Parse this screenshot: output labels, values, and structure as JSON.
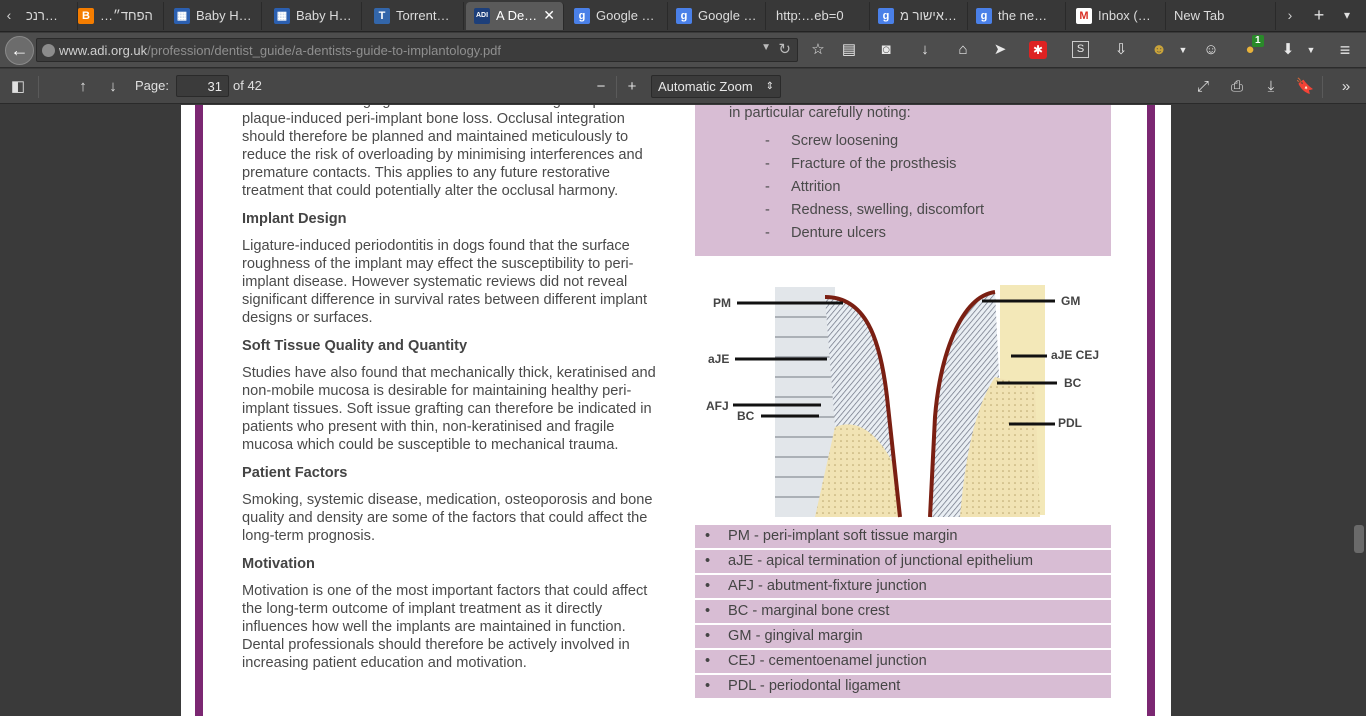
{
  "browser": {
    "tabs": [
      {
        "title": "רנכ…",
        "favicon": "none"
      },
      {
        "title": "…הפחד״",
        "favicon": "orange-blogger"
      },
      {
        "title": "Baby H…",
        "favicon": "colorful-grid"
      },
      {
        "title": "Baby H…",
        "favicon": "colorful-grid"
      },
      {
        "title": "Torrent…",
        "favicon": "torrent-t"
      },
      {
        "title": "A De…",
        "favicon": "adi-logo",
        "active": true
      },
      {
        "title": "Google …",
        "favicon": "google-g"
      },
      {
        "title": "Google …",
        "favicon": "google-g"
      },
      {
        "title": "http:…eb=0",
        "favicon": "none"
      },
      {
        "title": "אישור מ…",
        "favicon": "google-g"
      },
      {
        "title": "the ne…",
        "favicon": "google-g"
      },
      {
        "title": "Inbox (…",
        "favicon": "gmail-m"
      },
      {
        "title": "New Tab",
        "favicon": "none"
      }
    ],
    "tab_close_glyph": "✕",
    "newtab_glyph": "+",
    "url_domain": "www.adi.org.uk",
    "url_path": "/profession/dentist_guide/a-dentists-guide-to-implantology.pdf",
    "addon_badge": "1"
  },
  "pdf_toolbar": {
    "page_label": "Page:",
    "page_number": "31",
    "page_count": "of 42",
    "zoom": "Automatic Zoom"
  },
  "document": {
    "top_partial": "There is also emerging evidence that overloading can potentiate plaque-induced peri-implant bone loss. Occlusal integration should therefore be planned and maintained meticulously to reduce the risk of overloading by minimising interferences and premature contacts. This applies to any future restorative treatment that could potentially alter the occlusal harmony.",
    "sections": [
      {
        "heading": "Implant Design",
        "text": "Ligature-induced periodontitis in dogs found that the surface roughness of the implant may effect the susceptibility to peri-implant disease. However systematic reviews did not reveal significant difference in survival rates between different implant designs or surfaces."
      },
      {
        "heading": "Soft Tissue Quality and Quantity",
        "text": "Studies have also found that mechanically thick, keratinised and non-mobile mucosa is desirable for maintaining healthy peri-implant tissues. Soft issue grafting can therefore be indicated in patients who present with thin, non-keratinised and fragile mucosa which could be susceptible to mechanical trauma."
      },
      {
        "heading": "Patient Factors",
        "text": "Smoking, systemic disease, medication, osteoporosis and bone quality and density are some of the factors that could affect the long-term prognosis."
      },
      {
        "heading": "Motivation",
        "text": "Motivation is one of the most important factors that could affect the long-term outcome of implant treatment as it directly influences how well the implants are maintained in function. Dental professionals should therefore be actively involved in increasing patient education and motivation."
      }
    ],
    "callout_intro": "in particular carefully noting:",
    "callout_items": [
      "Screw loosening",
      "Fracture of the prosthesis",
      "Attrition",
      "Redness, swelling, discomfort",
      "Denture ulcers"
    ],
    "diagram_labels": {
      "pm": "PM",
      "aje": "aJE",
      "afj": "AFJ",
      "bc_left": "BC",
      "gm": "GM",
      "aje_cej": "aJE CEJ",
      "bc_right": "BC",
      "pdl": "PDL"
    },
    "legend": [
      "PM - peri-implant soft tissue margin",
      "aJE - apical termination of junctional epithelium",
      "AFJ - abutment-fixture junction",
      "BC - marginal bone crest",
      "GM - gingival margin",
      "CEJ - cementoenamel junction",
      "PDL - periodontal ligament"
    ]
  },
  "colors": {
    "page_accent": "#7b2772",
    "callout_bg": "#d8bdd4",
    "toolbar_bg": "#474747",
    "viewer_bg": "#3a3a3a"
  }
}
